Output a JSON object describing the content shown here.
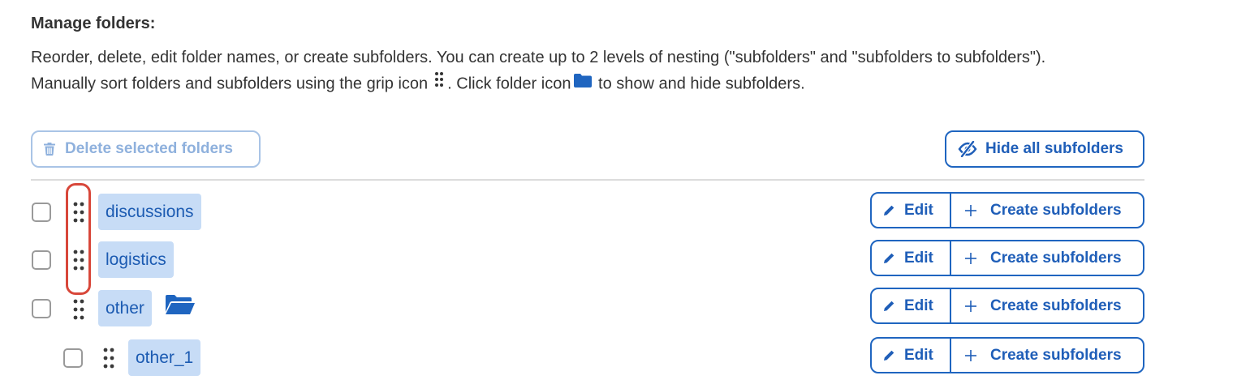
{
  "header": {
    "title": "Manage folders:",
    "description_part1": "Reorder, delete, edit folder names, or create subfolders. You can create up to 2 levels of nesting (\"subfolders\" and \"subfolders to subfolders\"). Manually sort folders and subfolders using the grip icon",
    "description_part2": ". Click folder icon",
    "description_part3": "to show and hide subfolders."
  },
  "toolbar": {
    "delete_label": "Delete selected folders",
    "hide_label": "Hide all subfolders"
  },
  "folders": [
    {
      "name": "discussions",
      "edit_label": "Edit",
      "create_label": "Create subfolders",
      "has_folder_icon": false,
      "level": 0
    },
    {
      "name": "logistics",
      "edit_label": "Edit",
      "create_label": "Create subfolders",
      "has_folder_icon": false,
      "level": 0
    },
    {
      "name": "other",
      "edit_label": "Edit",
      "create_label": "Create subfolders",
      "has_folder_icon": true,
      "level": 0
    },
    {
      "name": "other_1",
      "edit_label": "Edit",
      "create_label": "Create subfolders",
      "has_folder_icon": false,
      "level": 1
    }
  ],
  "icons": {
    "trash": "trash-icon",
    "eye_slash": "eye-slash-icon",
    "grip": "grip-icon",
    "folder": "folder-open-icon",
    "pencil": "pencil-icon",
    "plus": "plus-icon"
  },
  "colors": {
    "primary": "#1f65c0",
    "primary_text": "#1f5eb8",
    "disabled": "#8fb1dd",
    "folder_bg": "#c7dcf6",
    "highlight": "#d8473a"
  }
}
